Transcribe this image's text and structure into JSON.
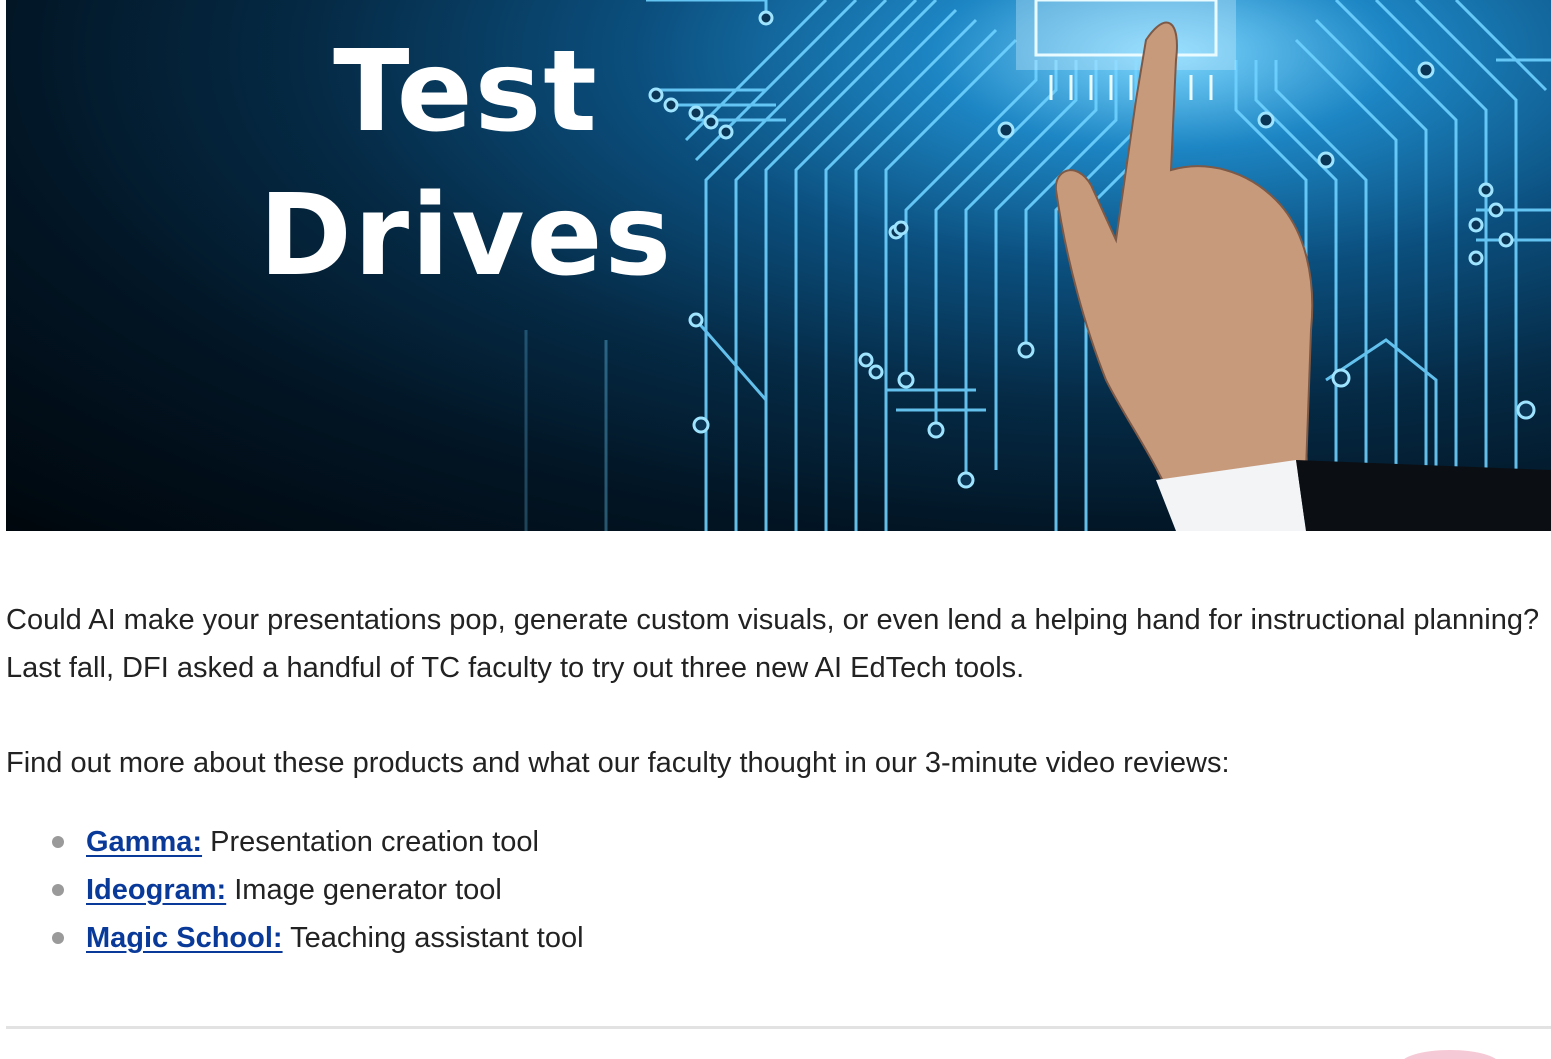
{
  "hero": {
    "title_line1": "Test",
    "title_line2": "Drives",
    "image_icon": "circuit-hand-icon"
  },
  "content": {
    "intro": "Could AI make your presentations pop, generate custom visuals, or even lend a helping hand for instructional planning? Last fall, DFI asked a handful of TC faculty to try out three new AI EdTech tools.",
    "find_out": "Find out more about these products and what our faculty thought in our 3-minute video reviews:"
  },
  "tools": [
    {
      "name": "Gamma:",
      "description": "Presentation creation tool"
    },
    {
      "name": "Ideogram:",
      "description": "Image generator tool"
    },
    {
      "name": "Magic School:",
      "description": "Teaching assistant tool"
    }
  ],
  "colors": {
    "link": "#0a3a99",
    "text": "#222222",
    "bullet": "#9a9a9a",
    "divider": "#e2e2e2",
    "hero_glow": "#7fd8ff",
    "hero_dark": "#00070d"
  }
}
